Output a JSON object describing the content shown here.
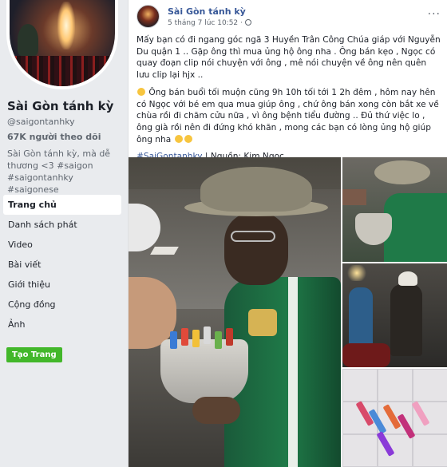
{
  "page": {
    "name": "Sài Gòn tánh kỳ",
    "handle": "@saigontanhky",
    "followers": "67K người theo dõi",
    "bio": "Sài Gòn tánh kỳ, mà dễ thương <3 #saigon #saigontanhky #saigonese",
    "nav_items": [
      "Trang chủ",
      "Danh sách phát",
      "Video",
      "Bài viết",
      "Giới thiệu",
      "Cộng đồng",
      "Ảnh"
    ],
    "create_button": "Tạo Trang"
  },
  "post": {
    "author": "Sài Gòn tánh kỳ",
    "timestamp": "5 tháng 7 lúc 10:52 ·",
    "more": "···",
    "paragraph1": "Mấy bạn có đi ngang góc ngã 3 Huyền Trân Công Chúa giáp với Nguyễn Du quận 1 .. Gặp ông thì mua ủng hộ ông nha . Ông bán kẹo , Ngọc có quay đoạn clip nói chuyện với ông , mê nói chuyện về ông nên quên lưu clip lại hjx ..",
    "paragraph2": "Ông bán buổi tối muộn cũng 9h 10h tối tới 1 2h đêm , hôm nay hên có Ngọc với bé em qua mua giúp ông , chứ ông bán xong còn bắt xe về chùa rồi đi chăm cửu nữa , vì ông bệnh tiểu đường .. Đủ thứ việc lo , ông già rồi nên đi đứng khó khăn , mong các bạn có lòng ủng hộ giúp ông nha",
    "hashtag": "#SaiGontanhky",
    "source": " | Nguồn: Kim Ngọc"
  },
  "colors": {
    "link": "#385898",
    "accent_green": "#42b72a",
    "background": "#e9ebee"
  }
}
